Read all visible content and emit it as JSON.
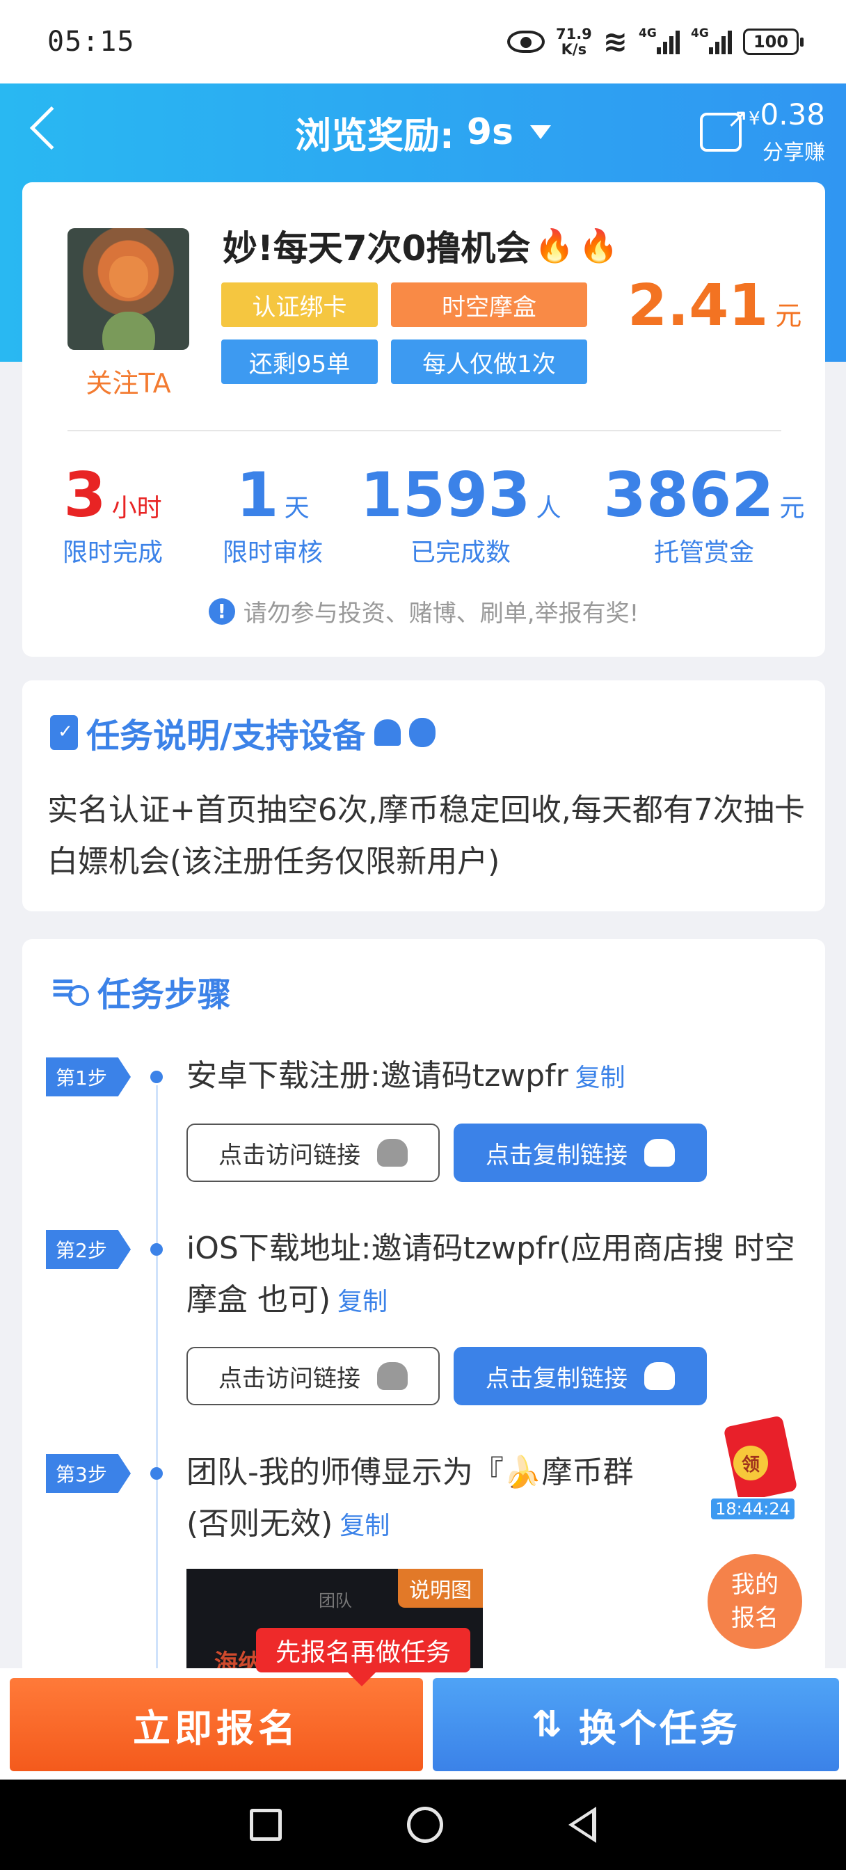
{
  "status": {
    "time": "05:15",
    "speed_top": "71.9",
    "speed_unit": "K/s",
    "sim1": "4G",
    "sim2": "4G",
    "battery": "100"
  },
  "header": {
    "title": "浏览奖励:",
    "seconds": "9s",
    "share_amount_symbol": "¥",
    "share_amount": "0.38",
    "share_label": "分享赚"
  },
  "task": {
    "follow": "关注TA",
    "title": "妙!每天7次0撸机会",
    "tags": [
      "认证绑卡",
      "时空摩盒",
      "还剩95单",
      "每人仅做1次"
    ],
    "price": "2.41",
    "price_unit": "元",
    "stats": [
      {
        "value": "3",
        "unit": "小时",
        "label": "限时完成"
      },
      {
        "value": "1",
        "unit": "天",
        "label": "限时审核"
      },
      {
        "value": "1593",
        "unit": "人",
        "label": "已完成数"
      },
      {
        "value": "3862",
        "unit": "元",
        "label": "托管赏金"
      }
    ],
    "warning": "请勿参与投资、赌博、刷单,举报有奖!"
  },
  "description": {
    "title": "任务说明/支持设备",
    "text": "实名认证+首页抽空6次,摩币稳定回收,每天都有7次抽卡白嫖机会(该注册任务仅限新用户)"
  },
  "steps": {
    "title": "任务步骤",
    "items": [
      {
        "badge": "第1步",
        "text": "安卓下载注册:邀请码tzwpfr",
        "copy": "复制",
        "visit": "点击访问链接",
        "copy_link": "点击复制链接"
      },
      {
        "badge": "第2步",
        "text": "iOS下载地址:邀请码tzwpfr(应用商店搜 时空摩盒 也可)",
        "copy": "复制",
        "visit": "点击访问链接",
        "copy_link": "点击复制链接"
      },
      {
        "badge": "第3步",
        "text": "团队-我的师傅显示为『🍌摩币群",
        "text2": "(否则无效)",
        "copy": "复制"
      }
    ],
    "screenshot_badge": "说明图",
    "screenshot_title": "团队",
    "screenshot_text": "海纳"
  },
  "floating": {
    "envelope_seal": "领",
    "timer": "18:44:24",
    "my_signup": "我的\n报名",
    "tooltip": "先报名再做任务"
  },
  "bottom": {
    "signup": "立即报名",
    "switch": "换个任务"
  },
  "colors": {
    "header_start": "#29b8f2",
    "header_end": "#3096f2",
    "accent_blue": "#3b82e8",
    "accent_orange": "#f45a1c"
  }
}
